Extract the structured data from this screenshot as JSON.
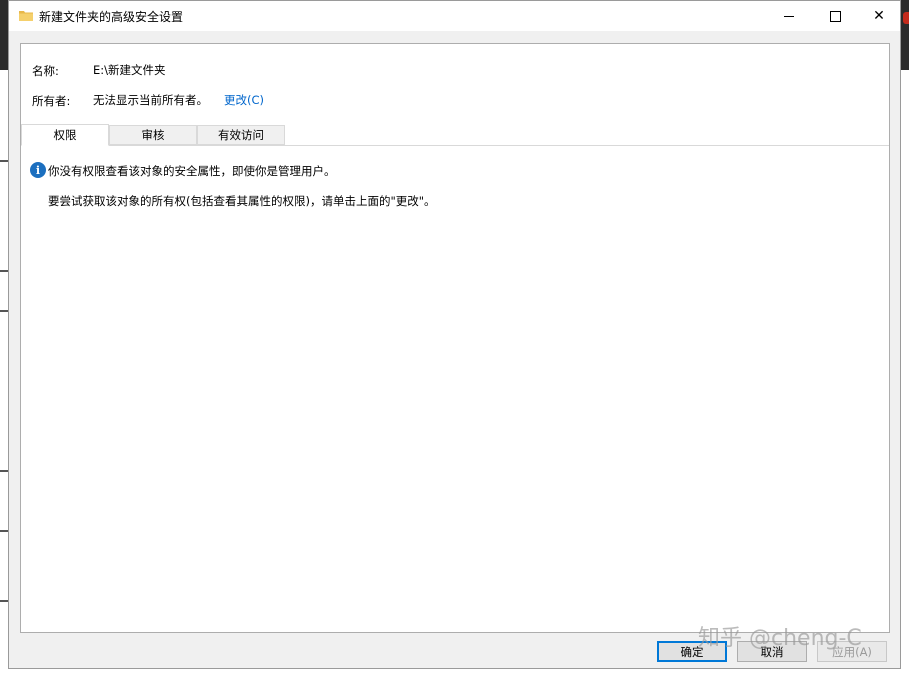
{
  "window": {
    "title": "新建文件夹的高级安全设置",
    "minimize_icon": "minimize-icon",
    "maximize_icon": "maximize-icon",
    "close_icon": "close-icon",
    "close_glyph": "✕"
  },
  "details": {
    "name_label": "名称:",
    "name_value": "E:\\新建文件夹",
    "owner_label": "所有者:",
    "owner_value": "无法显示当前所有者。",
    "change_link": "更改(C)"
  },
  "tabs": [
    {
      "label": "权限",
      "active": true
    },
    {
      "label": "审核",
      "active": false
    },
    {
      "label": "有效访问",
      "active": false
    }
  ],
  "message": {
    "info_icon": "info-icon",
    "info_glyph": "i",
    "line1": "你没有权限查看该对象的安全属性，即使你是管理用户。",
    "line2": "要尝试获取该对象的所有权(包括查看其属性的权限)，请单击上面的\"更改\"。"
  },
  "buttons": {
    "ok": "确定",
    "cancel": "取消",
    "apply": "应用(A)"
  },
  "watermark": "知乎 @cheng-C",
  "colors": {
    "accent": "#0078d7",
    "link": "#0066cc",
    "info": "#1c6fbf"
  }
}
